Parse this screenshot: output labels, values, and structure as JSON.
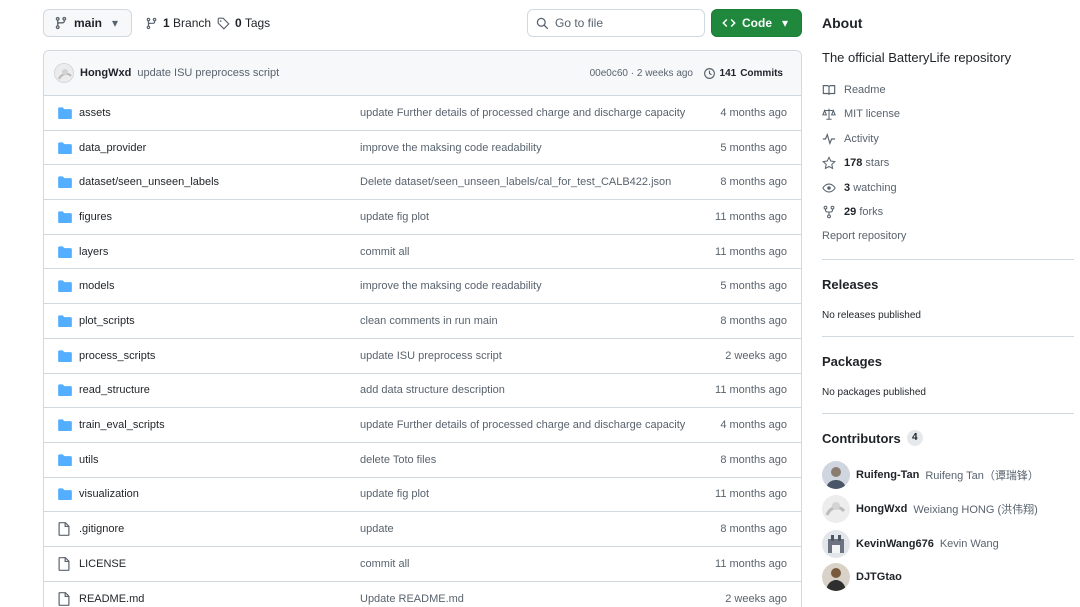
{
  "toolbar": {
    "branch": "main",
    "branches_count": "1",
    "branches_label": "Branch",
    "tags_count": "0",
    "tags_label": "Tags",
    "search_placeholder": "Go to file",
    "code_label": "Code"
  },
  "latest_commit": {
    "author": "HongWxd",
    "message": "update ISU preprocess script",
    "meta": "00e0c60 · 2 weeks ago",
    "commits_count": "141",
    "commits_label": "Commits"
  },
  "files": [
    {
      "name": "assets",
      "type": "dir",
      "message": "update Further details of processed charge and discharge capacity",
      "date": "4 months ago"
    },
    {
      "name": "data_provider",
      "type": "dir",
      "message": "improve the maksing code readability",
      "date": "5 months ago"
    },
    {
      "name": "dataset/seen_unseen_labels",
      "type": "dir",
      "message": "Delete dataset/seen_unseen_labels/cal_for_test_CALB422.json",
      "date": "8 months ago"
    },
    {
      "name": "figures",
      "type": "dir",
      "message": "update fig plot",
      "date": "11 months ago"
    },
    {
      "name": "layers",
      "type": "dir",
      "message": "commit all",
      "date": "11 months ago"
    },
    {
      "name": "models",
      "type": "dir",
      "message": "improve the maksing code readability",
      "date": "5 months ago"
    },
    {
      "name": "plot_scripts",
      "type": "dir",
      "message": "clean comments in run main",
      "date": "8 months ago"
    },
    {
      "name": "process_scripts",
      "type": "dir",
      "message": "update ISU preprocess script",
      "date": "2 weeks ago"
    },
    {
      "name": "read_structure",
      "type": "dir",
      "message": "add data structure description",
      "date": "11 months ago"
    },
    {
      "name": "train_eval_scripts",
      "type": "dir",
      "message": "update Further details of processed charge and discharge capacity",
      "date": "4 months ago"
    },
    {
      "name": "utils",
      "type": "dir",
      "message": "delete Toto files",
      "date": "8 months ago"
    },
    {
      "name": "visualization",
      "type": "dir",
      "message": "update fig plot",
      "date": "11 months ago"
    },
    {
      "name": ".gitignore",
      "type": "file",
      "message": "update",
      "date": "8 months ago"
    },
    {
      "name": "LICENSE",
      "type": "file",
      "message": "commit all",
      "date": "11 months ago"
    },
    {
      "name": "README.md",
      "type": "file",
      "message": "Update README.md",
      "date": "2 weeks ago"
    }
  ],
  "about": {
    "heading": "About",
    "description": "The official BatteryLife repository",
    "readme": "Readme",
    "license": "MIT license",
    "activity": "Activity",
    "stars_count": "178",
    "stars_label": "stars",
    "watching_count": "3",
    "watching_label": "watching",
    "forks_count": "29",
    "forks_label": "forks",
    "report": "Report repository"
  },
  "releases": {
    "heading": "Releases",
    "note": "No releases published"
  },
  "packages": {
    "heading": "Packages",
    "note": "No packages published"
  },
  "contributors": {
    "heading": "Contributors",
    "count": "4",
    "list": [
      {
        "login": "Ruifeng-Tan",
        "name": "Ruifeng Tan（谭瑞锋）"
      },
      {
        "login": "HongWxd",
        "name": "Weixiang HONG (洪伟翔)"
      },
      {
        "login": "KevinWang676",
        "name": "Kevin Wang"
      },
      {
        "login": "DJTGtao",
        "name": ""
      }
    ]
  },
  "colors": {
    "accent_green": "#1f883d",
    "folder_blue": "#54aeff",
    "muted_text": "#59636e",
    "border": "#d1d9e0"
  }
}
